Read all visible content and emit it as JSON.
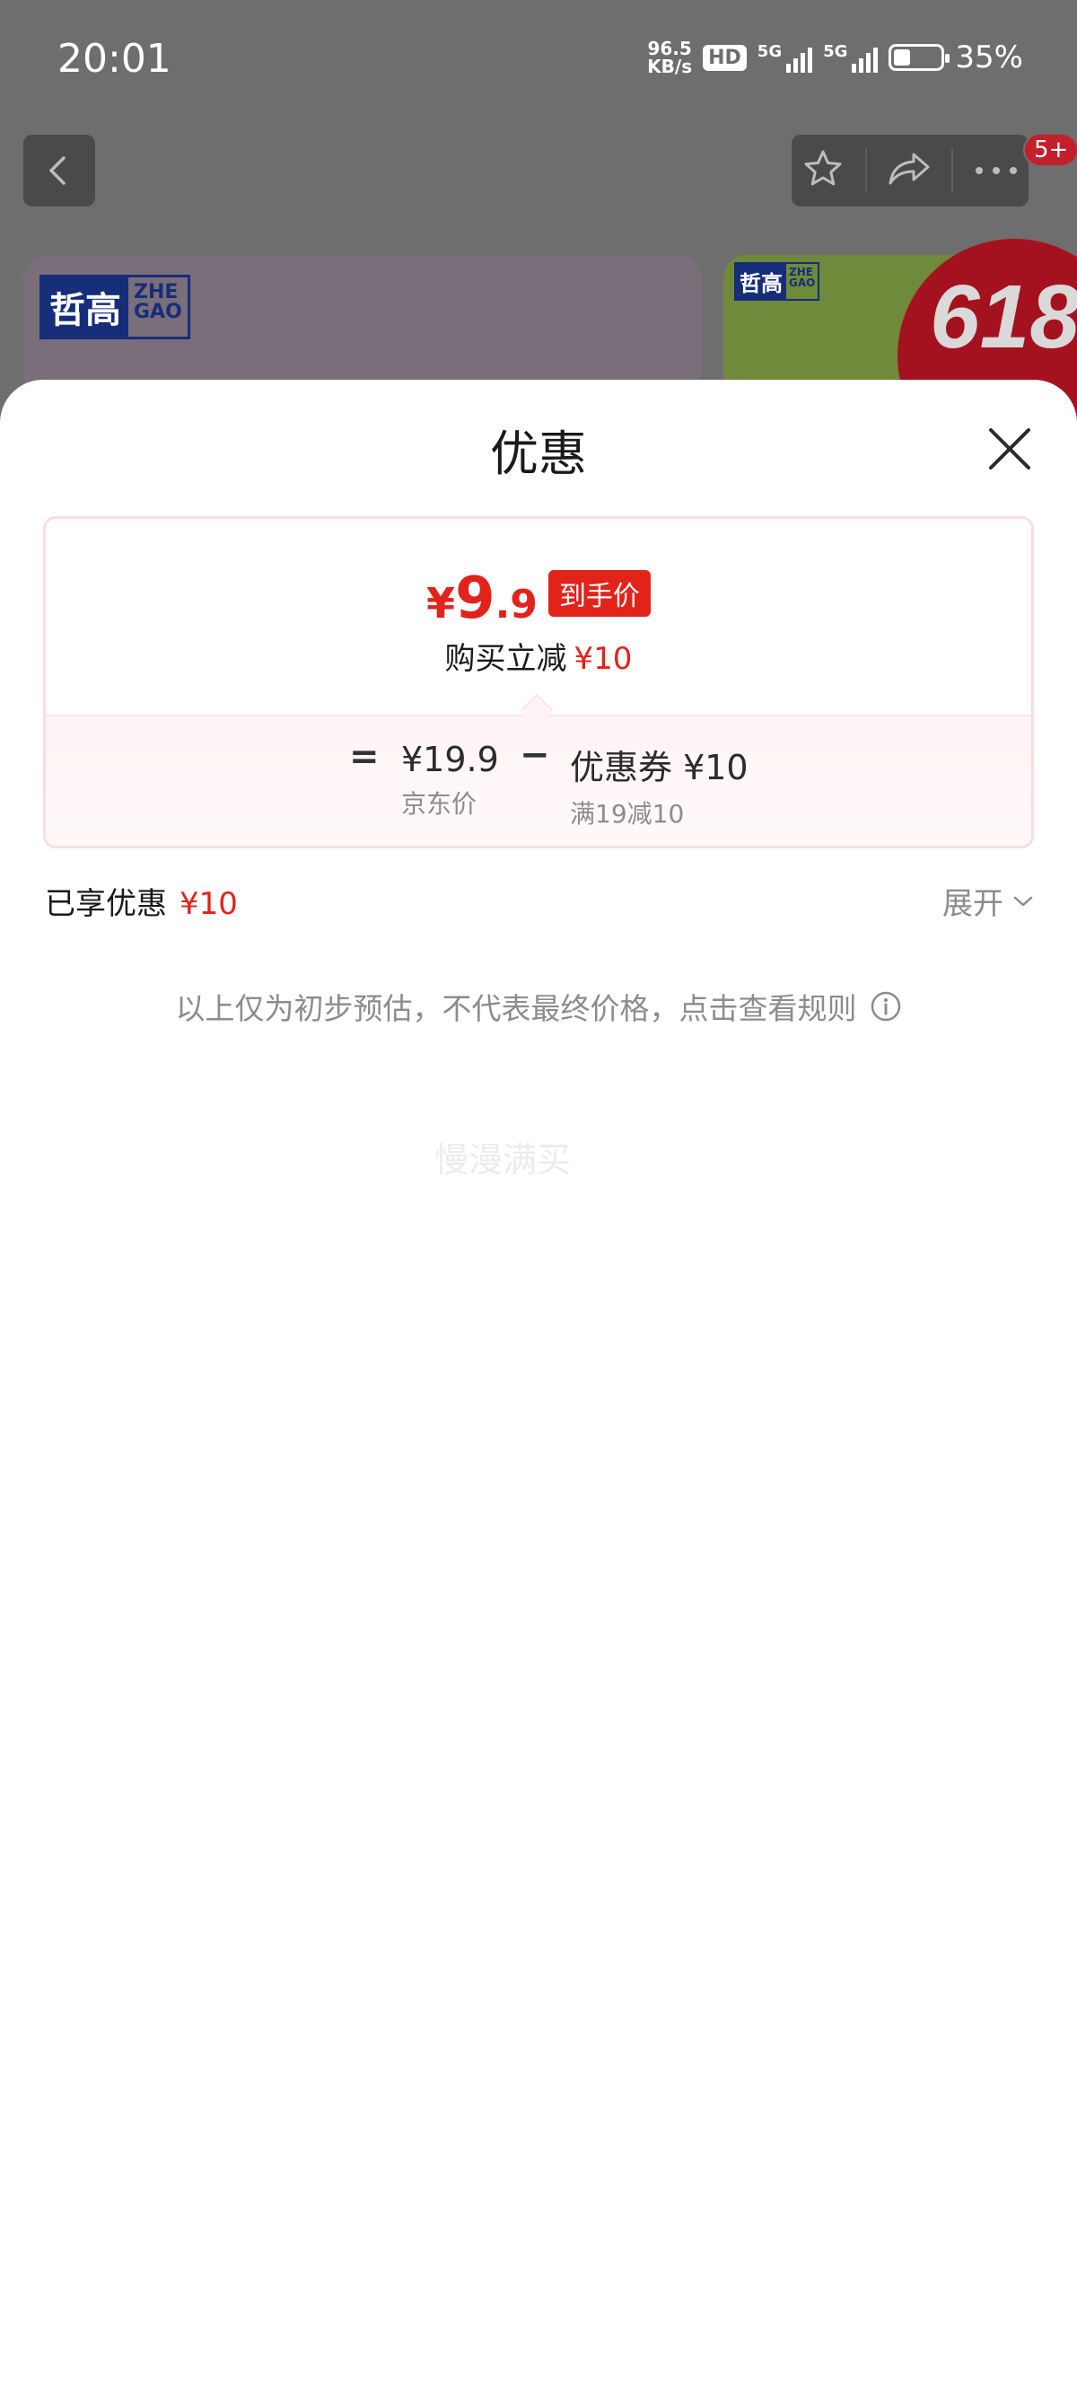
{
  "status_bar": {
    "time": "20:01",
    "net_speed_value": "96.5",
    "net_speed_unit": "KB/s",
    "hd_badge": "HD",
    "signal1_label": "5G",
    "signal2_label": "5G",
    "battery_level": 0.35,
    "battery_text": "35%"
  },
  "nav": {
    "back_icon": "chevron-left-icon",
    "favorite_icon": "star-icon",
    "share_icon": "share-icon",
    "more_icon": "more-icon",
    "message_badge": "5+"
  },
  "background": {
    "brand_cn": "哲高",
    "brand_en_line1": "ZHE",
    "brand_en_line2": "GAO",
    "promo_text": "618"
  },
  "sheet": {
    "title": "优惠",
    "close_icon": "close-icon",
    "final_price": {
      "currency": "¥",
      "integer": "9",
      "decimal": ".9",
      "tag": "到手价"
    },
    "reduce": {
      "label": "购买立减",
      "amount": "¥10"
    },
    "breakdown": {
      "equals": "=",
      "jd_price": "¥19.9",
      "jd_price_label": "京东价",
      "minus": "−",
      "coupon": "优惠券 ¥10",
      "coupon_rule": "满19减10"
    },
    "enjoyed": {
      "label": "已享优惠",
      "amount": "¥10"
    },
    "expand_label": "展开",
    "disclaimer": "以上仅为初步预估，不代表最终价格，点击查看规则",
    "watermark": "慢漫满买"
  },
  "colors": {
    "accent_red": "#e2231a",
    "overlay": "#6e6e6e"
  }
}
